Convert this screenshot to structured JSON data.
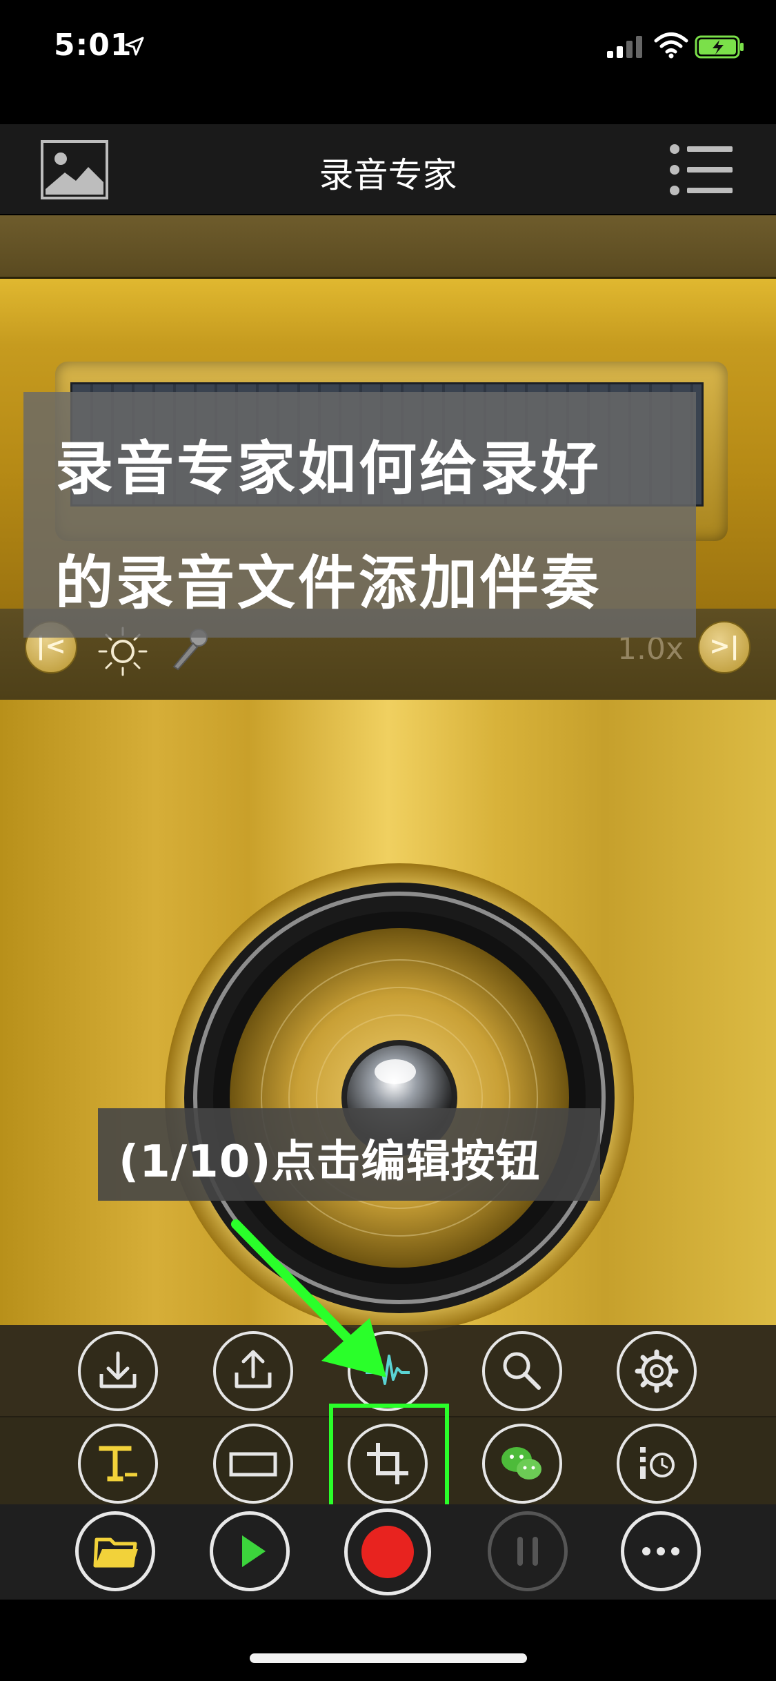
{
  "status_bar": {
    "time": "5:01",
    "icons": [
      "location-arrow-icon",
      "cellular-signal-icon",
      "wifi-icon",
      "battery-charging-icon"
    ]
  },
  "nav": {
    "title": "录音专家",
    "left_icon": "gallery-icon",
    "right_icon": "menu-list-icon"
  },
  "player": {
    "speed": "1.0x",
    "controls": [
      "skip-back-icon",
      "brightness-icon",
      "microphone-icon",
      "skip-forward-icon"
    ]
  },
  "overlay": {
    "title_line_1": "录音专家如何给录好",
    "title_line_2": "的录音文件添加伴奏",
    "hint": "(1/10)点击编辑按钮"
  },
  "toolbar": {
    "row1": [
      "download-icon",
      "share-icon",
      "waveform-icon",
      "search-icon",
      "settings-icon"
    ],
    "row2": [
      "text-icon",
      "rectangle-icon",
      "crop-edit-icon",
      "wechat-icon",
      "timer-list-icon"
    ]
  },
  "playbar": [
    "folder-icon",
    "play-icon",
    "record-icon",
    "pause-icon",
    "more-icon"
  ],
  "colors": {
    "highlight": "#2aff2a",
    "record": "#e8231f",
    "gold": "#d6ae38",
    "play_green": "#3cd43c"
  }
}
